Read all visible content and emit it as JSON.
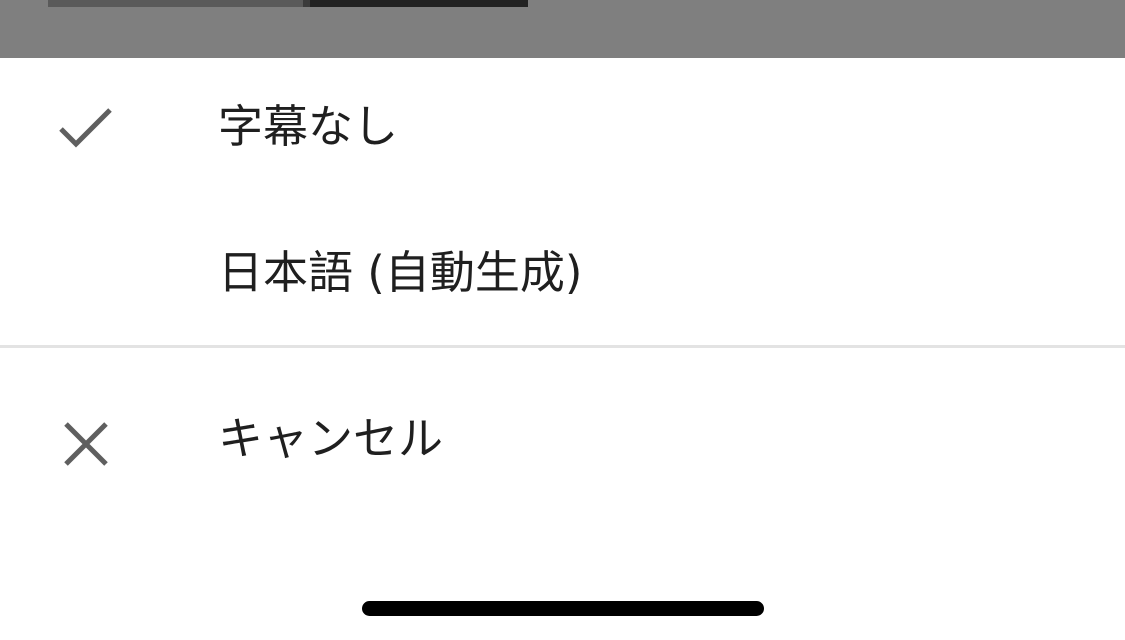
{
  "sheet": {
    "options": [
      {
        "label": "字幕なし",
        "icon": "check-icon",
        "selected": true
      },
      {
        "label": "日本語 (自動生成)",
        "icon": "",
        "selected": false
      }
    ],
    "cancel": {
      "label": "キャンセル",
      "icon": "close-icon"
    }
  },
  "colors": {
    "backdrop": "#7f7f7f",
    "icon": "#5f5f5f",
    "text": "#1f1f1f",
    "divider": "#e3e3e3"
  }
}
